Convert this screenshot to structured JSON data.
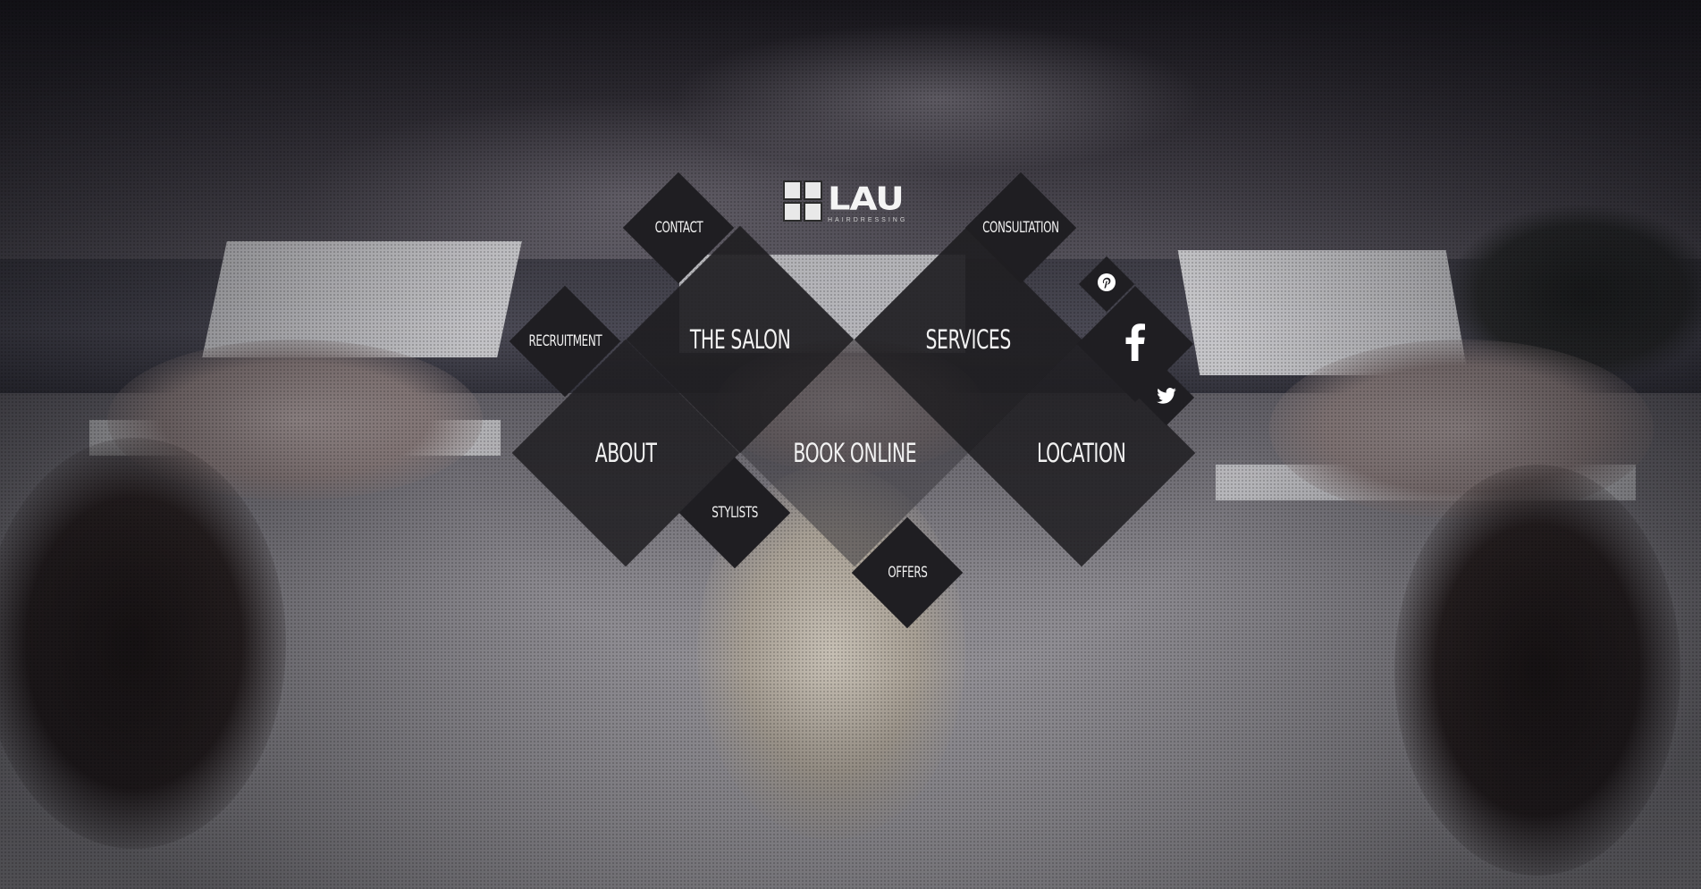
{
  "brand": {
    "name": "LAU",
    "tagline": "HAIRDRESSING",
    "seal_alt": "劉 logo seal"
  },
  "menu": {
    "contact": "CONTACT",
    "consultation": "CONSULTATION",
    "the_salon": "THE SALON",
    "services": "SERVICES",
    "recruitment": "RECRUITMENT",
    "about": "ABOUT",
    "book_online": "BOOK ONLINE",
    "location": "LOCATION",
    "stylists": "STYLISTS",
    "offers": "OFFERS"
  },
  "social": {
    "pinterest": "pinterest-icon",
    "facebook": "facebook-icon",
    "twitter": "twitter-icon"
  },
  "colors": {
    "tile_dark": "#1f1e22",
    "tile_mid": "#2a292e",
    "tile_translucent": "rgba(40,39,44,0.55)",
    "text": "#f2f2f2"
  }
}
